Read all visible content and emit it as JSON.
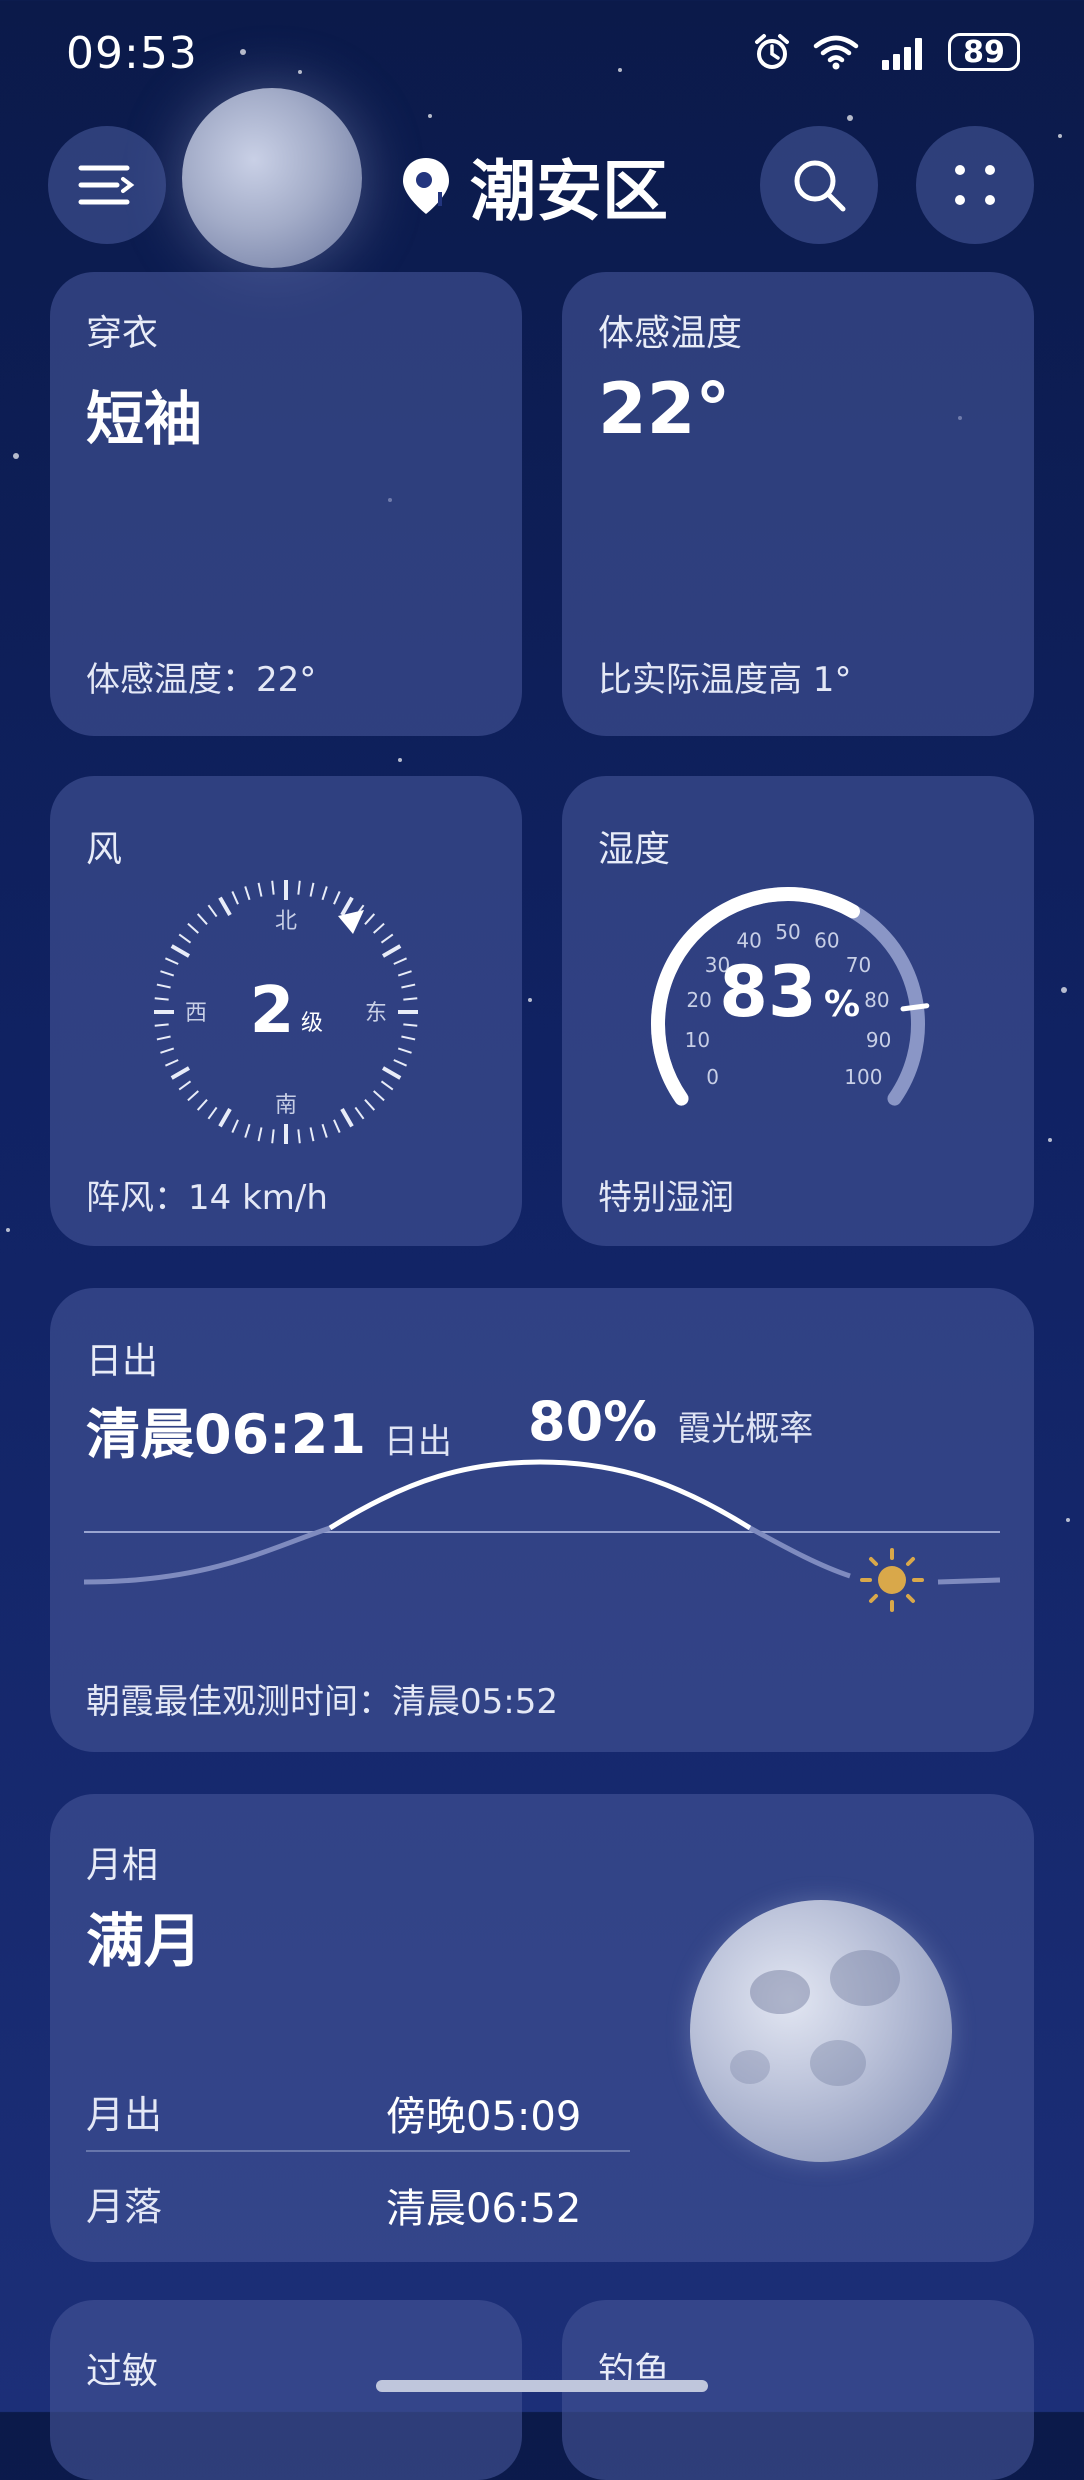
{
  "status_bar": {
    "time": "09:53",
    "battery": "89"
  },
  "header": {
    "city": "潮安区"
  },
  "cards": {
    "clothing": {
      "title": "穿衣",
      "value": "短袖",
      "note": "体感温度：22°"
    },
    "feels_like": {
      "title": "体感温度",
      "value": "22°",
      "note": "比实际温度高 1°"
    },
    "wind": {
      "title": "风",
      "level": "2",
      "level_unit": "级",
      "dirs": {
        "n": "北",
        "s": "南",
        "e": "东",
        "w": "西"
      },
      "gust": "阵风：14 km/h"
    },
    "humidity": {
      "title": "湿度",
      "value": "83",
      "unit": "%",
      "note": "特别湿润",
      "percent": 83,
      "ticks": [
        "0",
        "10",
        "20",
        "30",
        "40",
        "50",
        "60",
        "70",
        "80",
        "90",
        "100"
      ]
    },
    "sunrise": {
      "title": "日出",
      "time": "清晨06:21",
      "time_label": "日出",
      "chance": "80%",
      "chance_label": "霞光概率",
      "best_time": "朝霞最佳观测时间：清晨05:52"
    },
    "moon": {
      "title": "月相",
      "phase": "满月",
      "rise_label": "月出",
      "rise_time": "傍晚05:09",
      "set_label": "月落",
      "set_time": "清晨06:52"
    },
    "allergy": {
      "title": "过敏"
    },
    "fishing": {
      "title": "钓鱼"
    }
  },
  "colors": {
    "card_bg": "#43549a",
    "sun": "#d9a84a",
    "bg_top": "#0b1a4a"
  }
}
